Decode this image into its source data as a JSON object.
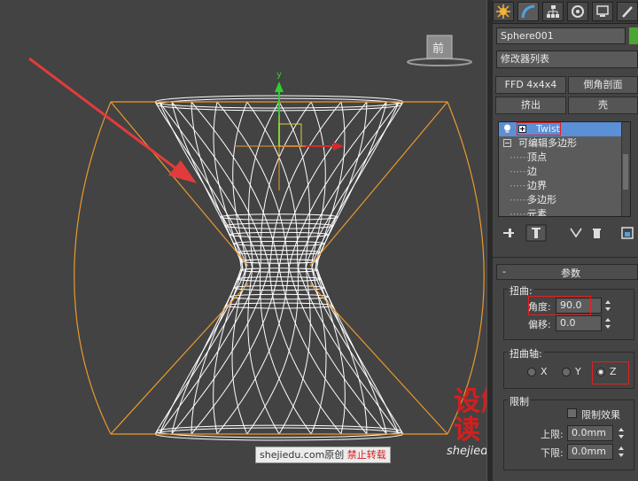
{
  "viewport": {
    "navcube_label": "前",
    "axis_label": "y"
  },
  "panel": {
    "tabs": [
      "create-icon",
      "modify-icon",
      "hierarchy-icon",
      "motion-icon",
      "display-icon",
      "utilities-icon"
    ],
    "object_name": "Sphere001",
    "object_color": "#4ca632",
    "modifier_list": "修改器列表",
    "buttons": {
      "ffd": "FFD 4x4x4",
      "bevel_profile": "倒角剖面",
      "extrude": "挤出",
      "shell": "壳"
    },
    "stack": [
      {
        "label": "Twist",
        "selected": true
      },
      {
        "label": "可编辑多边形",
        "selected": false
      },
      {
        "label": "顶点",
        "selected": false
      },
      {
        "label": "边",
        "selected": false
      },
      {
        "label": "边界",
        "selected": false
      },
      {
        "label": "多边形",
        "selected": false
      },
      {
        "label": "元素",
        "selected": false
      }
    ],
    "params_title": "参数",
    "twist": {
      "title": "扭曲:",
      "angle_label": "角度:",
      "angle_value": "90.0",
      "bias_label": "偏移:",
      "bias_value": "0.0"
    },
    "axis": {
      "title": "扭曲轴:",
      "x": "X",
      "y": "Y",
      "z": "Z",
      "selected": "Z"
    },
    "limits": {
      "title": "限制",
      "effect_label": "限制效果",
      "effect_checked": false,
      "upper_label": "上限:",
      "upper_value": "0.0mm",
      "lower_label": "下限:",
      "lower_value": "0.0mm"
    }
  },
  "watermark": {
    "brand": "设解读",
    "url": "shejiedu.com"
  },
  "caption": {
    "site": "shejiedu.com",
    "original": "原创",
    "notice": "禁止转载"
  },
  "colors": {
    "viewport_bg": "#434343",
    "wire": "#ffffff",
    "orange": "#e89a2c",
    "arrow": "#e23b3b",
    "highlight": "#e02020"
  }
}
